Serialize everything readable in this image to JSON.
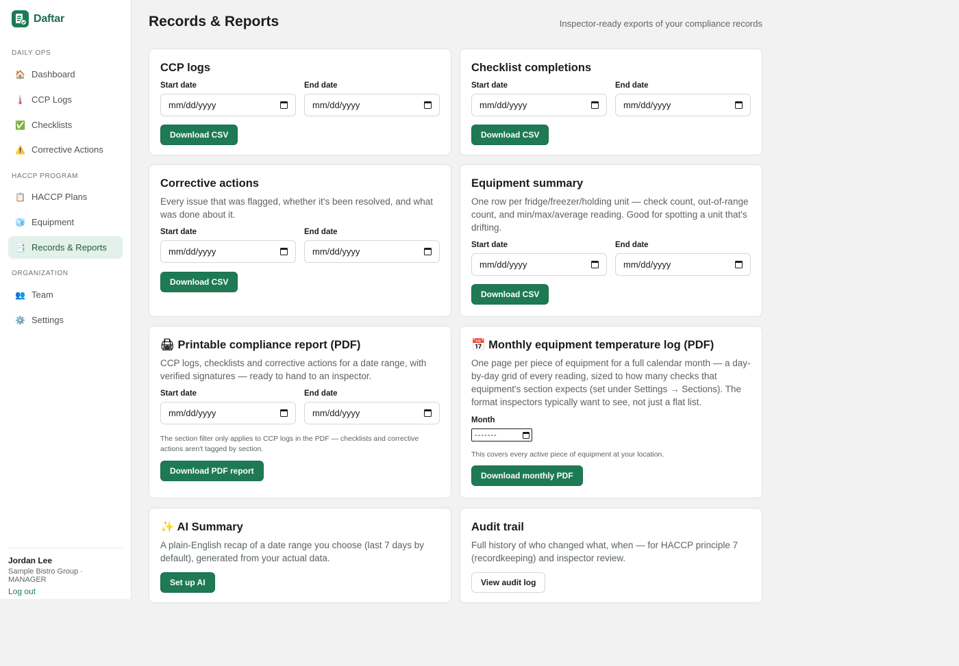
{
  "brand": {
    "name": "Daftar"
  },
  "nav": {
    "sections": [
      {
        "label": "DAILY OPS",
        "items": [
          {
            "label": "Dashboard",
            "icon": "house-icon",
            "glyph": "🏠"
          },
          {
            "label": "CCP Logs",
            "icon": "thermometer-icon",
            "glyph": "🌡️"
          },
          {
            "label": "Checklists",
            "icon": "check-icon",
            "glyph": "✅"
          },
          {
            "label": "Corrective Actions",
            "icon": "warning-icon",
            "glyph": "⚠️"
          }
        ]
      },
      {
        "label": "HACCP PROGRAM",
        "items": [
          {
            "label": "HACCP Plans",
            "icon": "clipboard-icon",
            "glyph": "📋"
          },
          {
            "label": "Equipment",
            "icon": "ice-cube-icon",
            "glyph": "🧊"
          },
          {
            "label": "Records & Reports",
            "icon": "bookmark-tabs-icon",
            "glyph": "📑",
            "active": true
          }
        ]
      },
      {
        "label": "ORGANIZATION",
        "items": [
          {
            "label": "Team",
            "icon": "people-icon",
            "glyph": "👥"
          },
          {
            "label": "Settings",
            "icon": "gear-icon",
            "glyph": "⚙️"
          }
        ]
      }
    ]
  },
  "user": {
    "name": "Jordan Lee",
    "org": "Sample Bistro Group · MANAGER",
    "logout": "Log out"
  },
  "header": {
    "title": "Records & Reports",
    "subtitle": "Inspector-ready exports of your compliance records"
  },
  "common": {
    "start_label": "Start date",
    "end_label": "End date",
    "date_placeholder": "mm/dd/yyyy",
    "download_csv": "Download CSV"
  },
  "cards": {
    "ccp": {
      "title": "CCP logs"
    },
    "checklist": {
      "title": "Checklist completions"
    },
    "corrective": {
      "title": "Corrective actions",
      "desc": "Every issue that was flagged, whether it's been resolved, and what was done about it."
    },
    "equipment": {
      "title": "Equipment summary",
      "desc": "One row per fridge/freezer/holding unit — check count, out-of-range count, and min/max/average reading. Good for spotting a unit that's drifting."
    },
    "pdf": {
      "icon_glyph": "🖨",
      "title": "Printable compliance report (PDF)",
      "desc": "CCP logs, checklists and corrective actions for a date range, with verified signatures — ready to hand to an inspector.",
      "note": "The section filter only applies to CCP logs in the PDF — checklists and corrective actions aren't tagged by section.",
      "button": "Download PDF report"
    },
    "monthly": {
      "icon_glyph": "📅",
      "title": "Monthly equipment temperature log (PDF)",
      "desc": "One page per piece of equipment for a full calendar month — a day-by-day grid of every reading, sized to how many checks that equipment's section expects (set under Settings → Sections). The format inspectors typically want to see, not just a flat list.",
      "month_label": "Month",
      "month_placeholder": "-------",
      "note": "This covers every active piece of equipment at your location.",
      "button": "Download monthly PDF"
    },
    "ai": {
      "icon_glyph": "✨",
      "title": "AI Summary",
      "desc": "A plain-English recap of a date range you choose (last 7 days by default), generated from your actual data.",
      "button": "Set up AI"
    },
    "audit": {
      "title": "Audit trail",
      "desc": "Full history of who changed what, when — for HACCP principle 7 (recordkeeping) and inspector review.",
      "button": "View audit log"
    }
  }
}
